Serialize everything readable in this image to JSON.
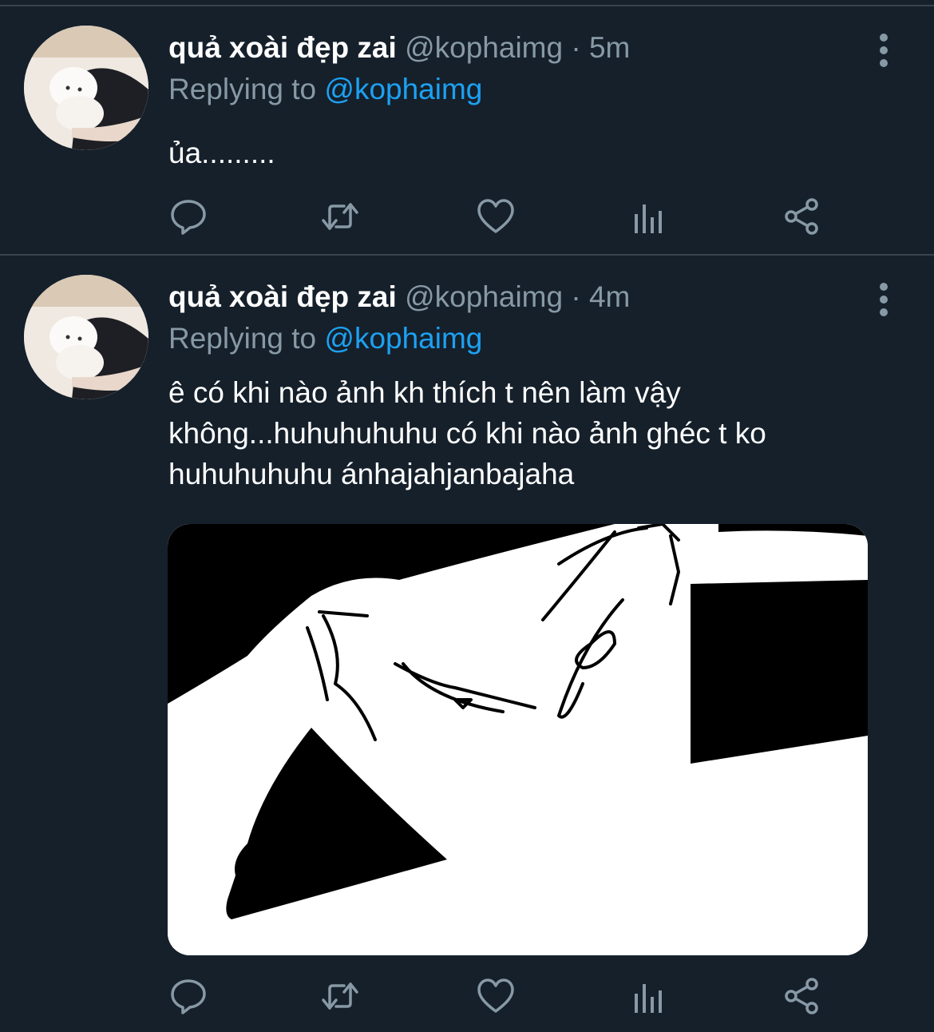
{
  "theme": {
    "background": "#15202b",
    "divider": "#38444d",
    "text_primary": "#ffffff",
    "text_secondary": "#8899a6",
    "accent": "#1da1f2"
  },
  "tweets": [
    {
      "display_name": "quả xoài đẹp zai",
      "handle": "@kophaimg",
      "separator": "·",
      "time": "5m",
      "reply_prefix": "Replying to",
      "reply_to": "@kophaimg",
      "text": "ủa.........",
      "avatar_icon": "cat-avatar",
      "actions": [
        "reply-icon",
        "retweet-icon",
        "like-icon",
        "analytics-icon",
        "share-icon"
      ]
    },
    {
      "display_name": "quả xoài đẹp zai",
      "handle": "@kophaimg",
      "separator": "·",
      "time": "4m",
      "reply_prefix": "Replying to",
      "reply_to": "@kophaimg",
      "text": "ê có khi nào ảnh kh thích t nên làm vậy không...huhuhuhuhu có khi nào ảnh ghéc t ko huhuhuhuhu ánhajahjanbajaha",
      "avatar_icon": "cat-avatar",
      "media_icon": "sketch-drawing-image",
      "actions": [
        "reply-icon",
        "retweet-icon",
        "like-icon",
        "analytics-icon",
        "share-icon"
      ]
    }
  ]
}
